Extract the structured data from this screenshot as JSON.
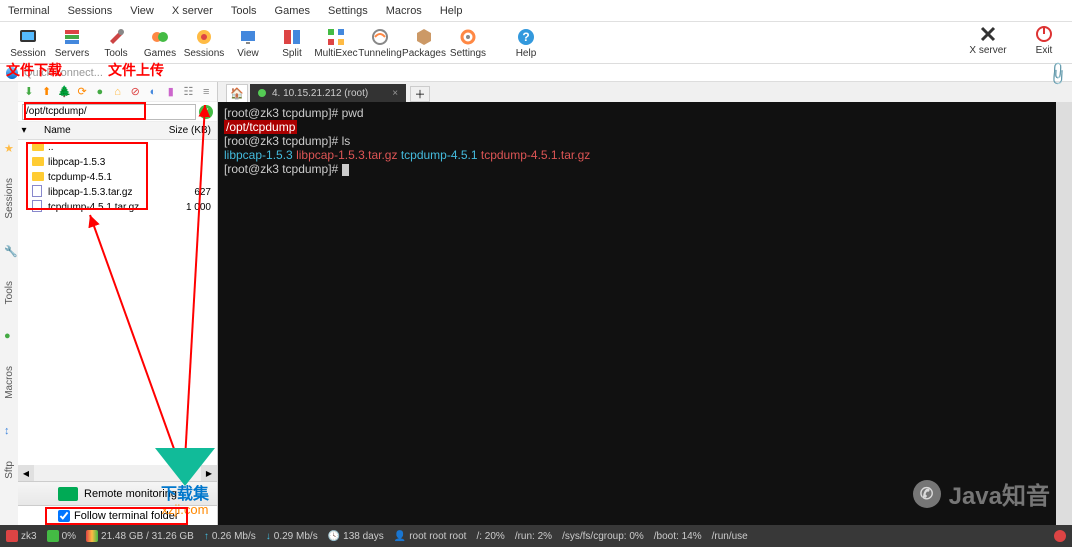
{
  "menu": {
    "items": [
      "Terminal",
      "Sessions",
      "View",
      "X server",
      "Tools",
      "Games",
      "Settings",
      "Macros",
      "Help"
    ]
  },
  "toolbar": {
    "buttons": [
      "Session",
      "Servers",
      "Tools",
      "Games",
      "Sessions",
      "View",
      "Split",
      "MultiExec",
      "Tunneling",
      "Packages",
      "Settings",
      "Help"
    ],
    "right": [
      "X server",
      "Exit"
    ]
  },
  "quick_connect": {
    "text": "Quick connect..."
  },
  "annotations": {
    "download": "文件下载",
    "upload": "文件上传"
  },
  "side_tabs": [
    "Sessions",
    "Tools",
    "Macros",
    "Sftp"
  ],
  "sftp": {
    "path": "/opt/tcpdump/",
    "headers": {
      "name": "Name",
      "size": "Size (KB)"
    },
    "files": [
      {
        "icon": "folder",
        "name": "..",
        "size": ""
      },
      {
        "icon": "folder",
        "name": "libpcap-1.5.3",
        "size": ""
      },
      {
        "icon": "folder",
        "name": "tcpdump-4.5.1",
        "size": ""
      },
      {
        "icon": "file",
        "name": "libpcap-1.5.3.tar.gz",
        "size": "627"
      },
      {
        "icon": "file",
        "name": "tcpdump-4.5.1.tar.gz",
        "size": "1 000"
      }
    ],
    "remote_monitor": "Remote monitoring",
    "follow": "Follow terminal folder"
  },
  "tabs": {
    "active": "4. 10.15.21.212 (root)"
  },
  "terminal": {
    "lines": [
      {
        "prompt": "[root@zk3 tcpdump]# ",
        "cmd": "pwd"
      },
      {
        "path_hl": "/opt/tcpdump"
      },
      {
        "prompt": "[root@zk3 tcpdump]# ",
        "cmd": "ls"
      },
      {
        "ls_out": [
          {
            "t": "libpcap-1.5.3",
            "c": "cyan"
          },
          {
            "t": "libpcap-1.5.3.tar.gz",
            "c": "red"
          },
          {
            "t": "tcpdump-4.5.1",
            "c": "cyan"
          },
          {
            "t": "tcpdump-4.5.1.tar.gz",
            "c": "red"
          }
        ]
      },
      {
        "prompt": "[root@zk3 tcpdump]# ",
        "cursor": true
      }
    ]
  },
  "statusbar": {
    "host": "zk3",
    "cpu": "0%",
    "mem": "21.48 GB / 31.26 GB",
    "up": "0.26 Mb/s",
    "down": "0.29 Mb/s",
    "uptime": "138 days",
    "user": "root root root",
    "fs1": "/: 20%",
    "fs2": "/run: 2%",
    "fs3": "/sys/fs/cgroup: 0%",
    "fs4": "/boot: 14%",
    "fs5": "/run/use"
  },
  "watermark": {
    "text": "Java知音"
  },
  "xzji": {
    "line1": "下载集",
    "line2": "xzji.com"
  }
}
